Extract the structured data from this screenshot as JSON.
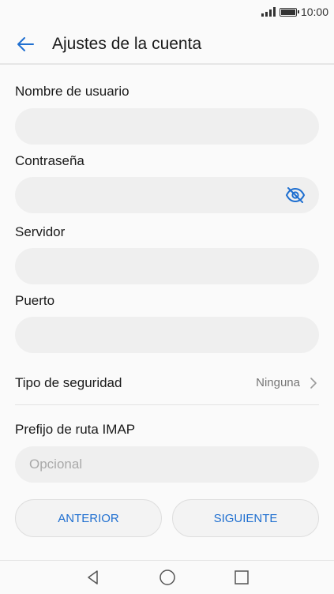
{
  "status_bar": {
    "time": "10:00"
  },
  "header": {
    "title": "Ajustes de la cuenta",
    "back_icon": "arrow-left-icon"
  },
  "form": {
    "username": {
      "label": "Nombre de usuario",
      "value": ""
    },
    "password": {
      "label": "Contraseña",
      "value": "",
      "toggle_icon": "eye-off-icon"
    },
    "server": {
      "label": "Servidor",
      "value": ""
    },
    "port": {
      "label": "Puerto",
      "value": ""
    },
    "security": {
      "label": "Tipo de seguridad",
      "value": "Ninguna"
    },
    "imap_prefix": {
      "label": "Prefijo de ruta IMAP",
      "value": "",
      "placeholder": "Opcional"
    }
  },
  "buttons": {
    "previous": "ANTERIOR",
    "next": "SIGUIENTE"
  },
  "nav_bar": {
    "icons": [
      "back-triangle-icon",
      "home-circle-icon",
      "recents-square-icon"
    ]
  },
  "colors": {
    "accent": "#1f6fd0",
    "input_bg": "#efefef",
    "background": "#fafafa"
  }
}
